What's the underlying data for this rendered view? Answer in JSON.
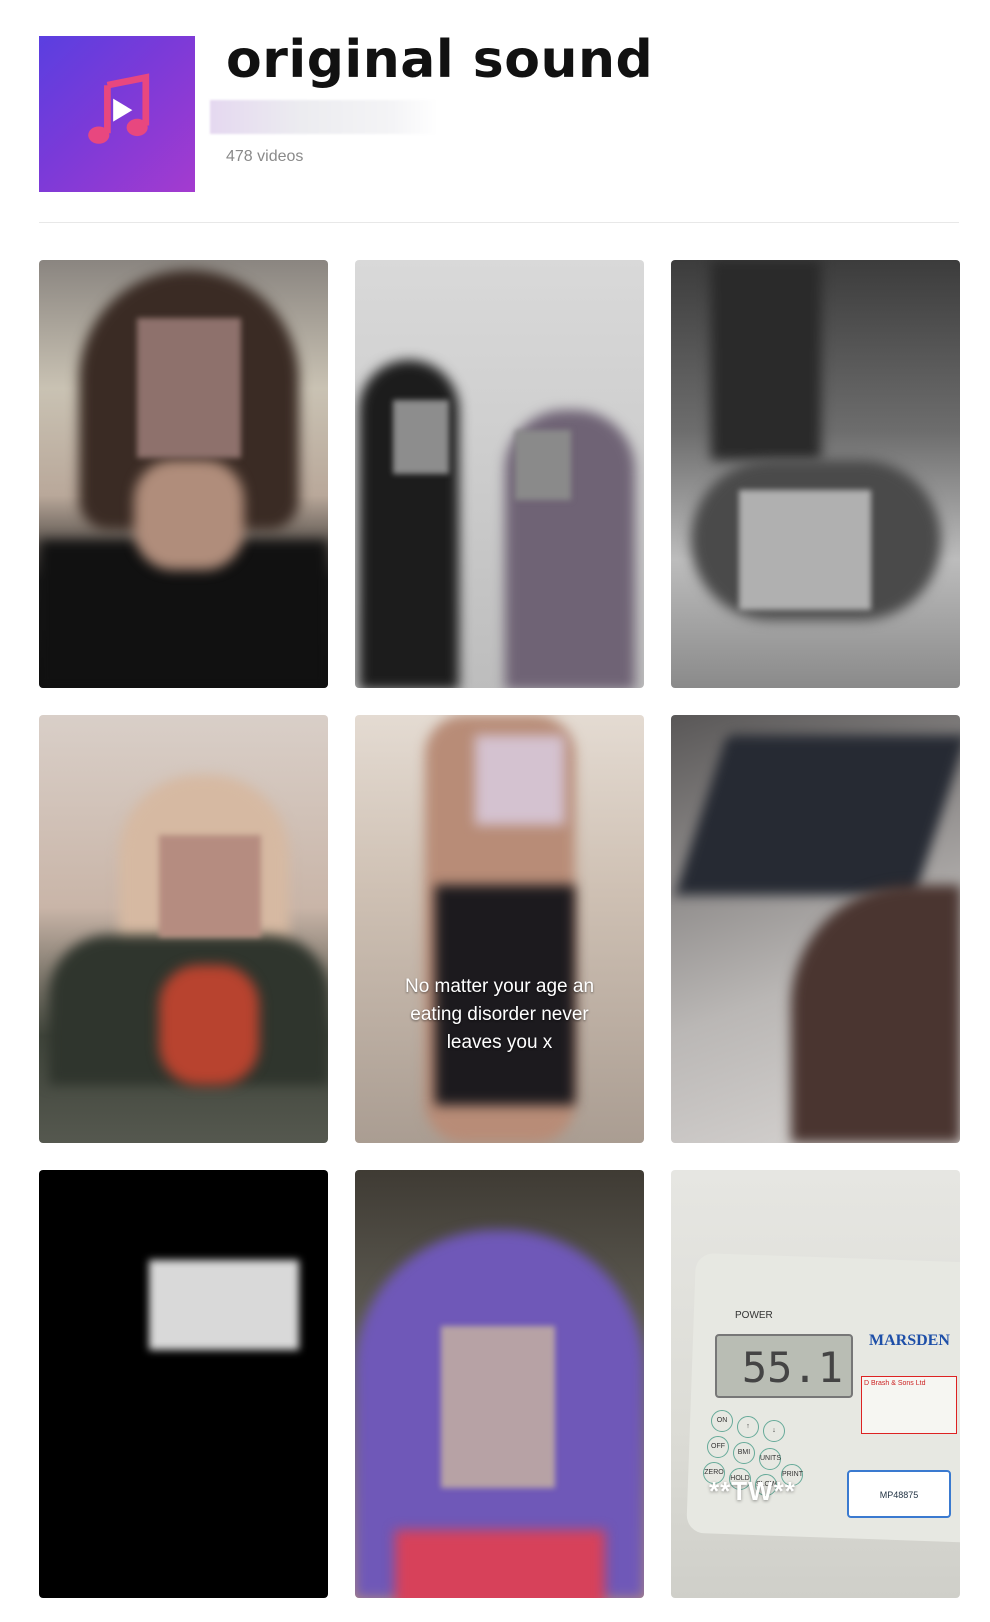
{
  "header": {
    "title": "original sound",
    "video_count": "478 videos"
  },
  "videos": [
    {
      "kind": "portrait-black-top"
    },
    {
      "kind": "two-girls-room"
    },
    {
      "kind": "grayscale-head"
    },
    {
      "kind": "blonde-hair"
    },
    {
      "kind": "mirror-selfie",
      "caption": "No matter your age an eating disorder never leaves you x"
    },
    {
      "kind": "radiator-closeup"
    },
    {
      "kind": "dark-screen"
    },
    {
      "kind": "purple-hair"
    },
    {
      "kind": "weighing-scale",
      "caption": "**TW**",
      "display": "55.1",
      "brand": "MARSDEN",
      "power_label": "POWER"
    }
  ],
  "colors": {
    "cover_start": "#5a3fe0",
    "cover_end": "#a43bcf",
    "note": "#e8477f",
    "count_text": "#8a8a8a"
  }
}
